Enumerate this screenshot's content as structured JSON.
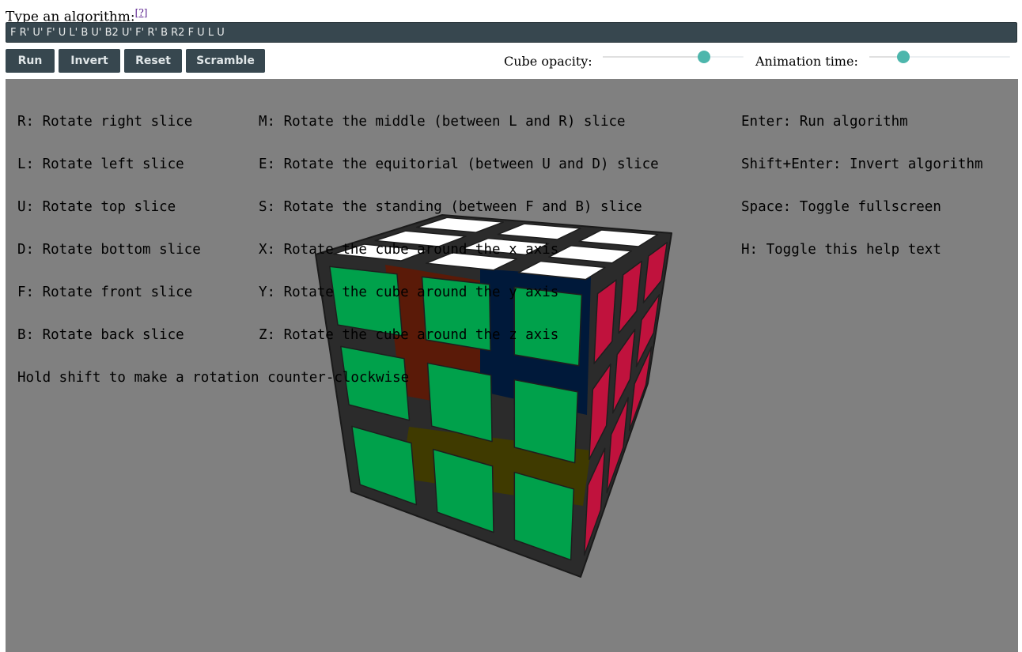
{
  "header": {
    "prompt": "Type an algorithm:",
    "help_link": "[?]"
  },
  "algorithm_input": {
    "value": "F R' U' F' U L' B U' B2 U' F' R' B R2 F U L U"
  },
  "buttons": {
    "run": "Run",
    "invert": "Invert",
    "reset": "Reset",
    "scramble": "Scramble"
  },
  "controls": {
    "opacity_label": "Cube opacity:",
    "opacity_value": 0.72,
    "animation_label": "Animation time:",
    "animation_value": 0.24,
    "accent_color": "#4db6ac"
  },
  "help": {
    "col1": [
      "R: Rotate right slice",
      "L: Rotate left slice",
      "U: Rotate top slice",
      "D: Rotate bottom slice",
      "F: Rotate front slice",
      "B: Rotate back slice",
      "Hold shift to make a rotation counter-clockwise"
    ],
    "col2": [
      "M: Rotate the middle (between L and R) slice",
      "E: Rotate the equitorial (between U and D) slice",
      "S: Rotate the standing (between F and B) slice",
      "X: Rotate the cube around the x axis",
      "Y: Rotate the cube around the y axis",
      "Z: Rotate the cube around the z axis"
    ],
    "col3": [
      "Enter: Run algorithm",
      "Shift+Enter: Invert algorithm",
      "Space: Toggle fullscreen",
      "H: Toggle this help text"
    ]
  },
  "cube": {
    "front_color": "#00a14b",
    "top_color": "#ffffff",
    "right_color": "#c0123d",
    "body_color": "#2b2b2b",
    "inner_colors": [
      "#5a1a08",
      "#00193a",
      "#3f3a00"
    ],
    "background": "#808080"
  }
}
